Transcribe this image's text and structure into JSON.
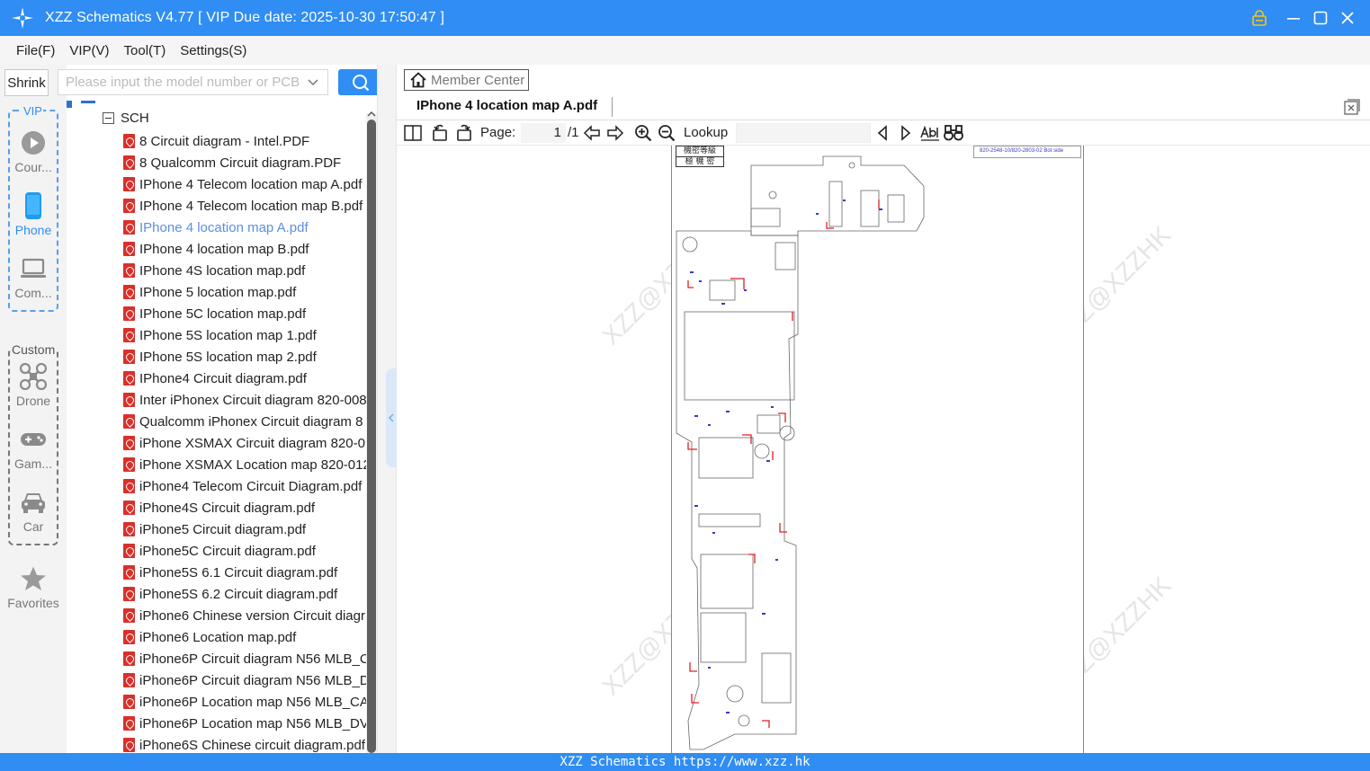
{
  "titlebar": {
    "title": "XZZ Schematics V4.77 [ VIP Due date: 2025-10-30 17:50:47 ]"
  },
  "menu": {
    "items": [
      "File(F)",
      "VIP(V)",
      "Tool(T)",
      "Settings(S)"
    ]
  },
  "leftnav": {
    "shrink_label": "Shrink",
    "vip_label": "VIP",
    "custom_label": "Custom",
    "items": [
      {
        "label": "Cour...",
        "icon": "play-circle-icon"
      },
      {
        "label": "Phone",
        "icon": "phone-icon",
        "active": true
      },
      {
        "label": "Com...",
        "icon": "laptop-icon"
      },
      {
        "label": "Drone",
        "icon": "drone-icon"
      },
      {
        "label": "Gam...",
        "icon": "gamepad-icon"
      },
      {
        "label": "Car",
        "icon": "car-icon"
      },
      {
        "label": "Favorites",
        "icon": "star-icon"
      }
    ]
  },
  "search": {
    "placeholder": "Please input the model number or PCB"
  },
  "tree": {
    "folder": "SCH",
    "files": [
      "8 Circuit diagram - Intel.PDF",
      "8 Qualcomm Circuit diagram.PDF",
      "IPhone 4 Telecom location map A.pdf",
      "IPhone 4 Telecom location map B.pdf",
      "IPhone 4 location map A.pdf",
      "IPhone 4 location map B.pdf",
      "IPhone 4S location map.pdf",
      "IPhone 5 location map.pdf",
      "IPhone 5C location map.pdf",
      "IPhone 5S location map 1.pdf",
      "IPhone 5S location map 2.pdf",
      "IPhone4 Circuit diagram.pdf",
      "Inter iPhonex Circuit diagram 820-008",
      "Qualcomm iPhonex Circuit diagram 8",
      "iPhone XSMAX Circuit diagram 820-0",
      "iPhone XSMAX Location map 820-012",
      "iPhone4 Telecom Circuit Diagram.pdf",
      "iPhone4S Circuit diagram.pdf",
      "iPhone5 Circuit diagram.pdf",
      "iPhone5C Circuit diagram.pdf",
      "iPhone5S 6.1 Circuit diagram.pdf",
      "iPhone5S 6.2 Circuit diagram.pdf",
      "iPhone6 Chinese version Circuit diagr",
      "iPhone6 Location map.pdf",
      "iPhone6P Circuit diagram N56 MLB_C",
      "iPhone6P Circuit diagram N56 MLB_D",
      "iPhone6P Location map N56 MLB_CA",
      "iPhone6P Location map N56 MLB_DV",
      "iPhone6S Chinese circuit diagram.pdf"
    ],
    "selected_index": 4
  },
  "viewer": {
    "member_center": "Member Center",
    "tab_title": "IPhone 4 location map A.pdf",
    "page_label": "Page:",
    "page_current": "1",
    "page_total": "/1",
    "lookup_label": "Lookup",
    "pdf_header_line1": "機密等級",
    "pdf_header_line2": "極 機 密",
    "pdf_ref": "820-2548-10/820-2803-02 Bot side",
    "watermark": "XZZ@XZZHK"
  },
  "status": {
    "text": "XZZ Schematics https://www.xzz.hk"
  },
  "colors": {
    "accent": "#2f8df3",
    "selected_file": "#5b8fe0",
    "pdf_red": "#d9302b"
  }
}
